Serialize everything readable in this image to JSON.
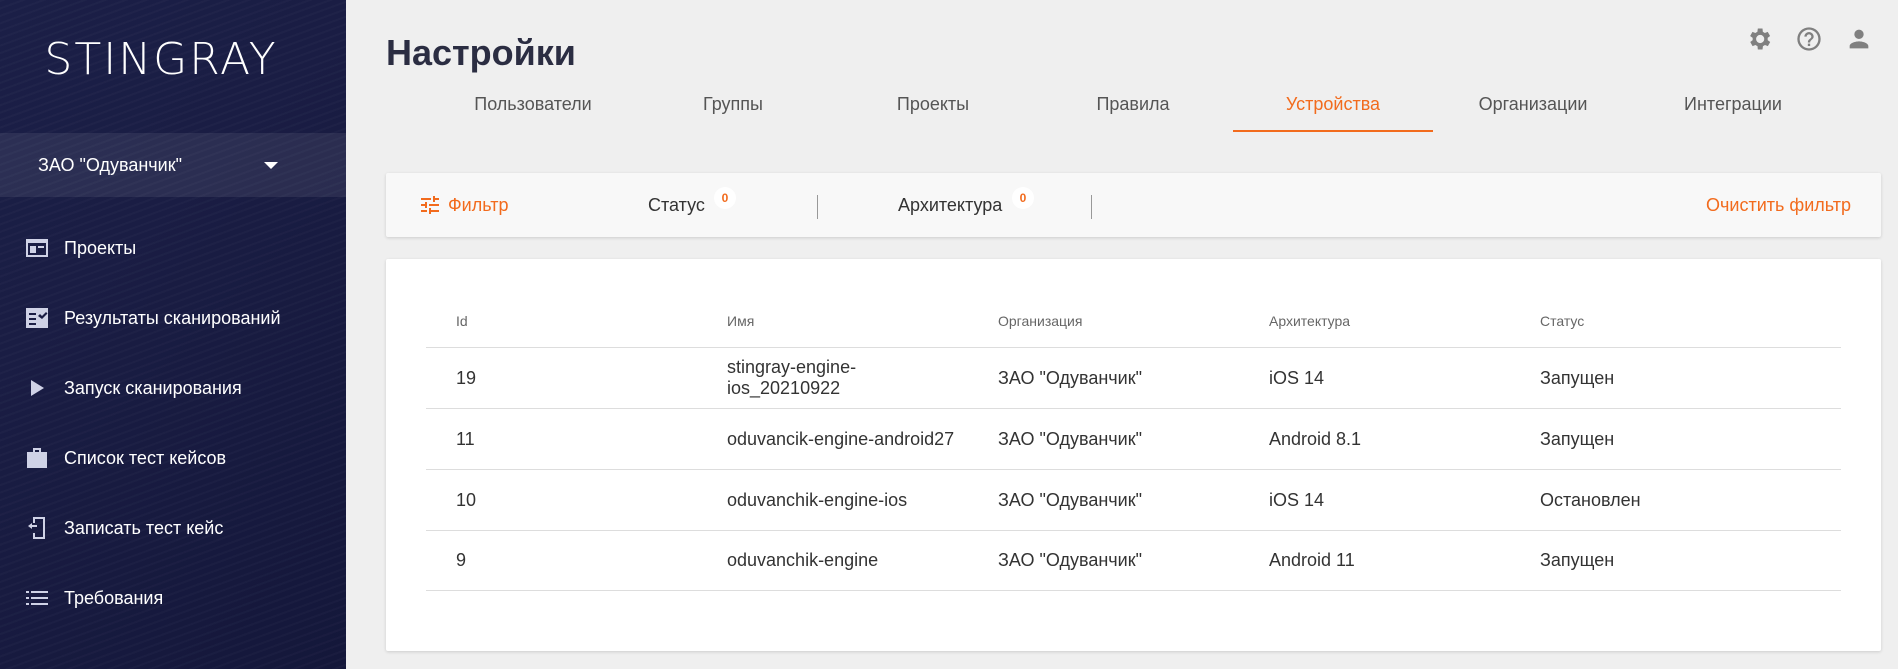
{
  "sidebar": {
    "logo": "STINGRAY",
    "org": "ЗАО \"Одуванчик\"",
    "items": [
      {
        "label": "Проекты",
        "icon": "projects-icon"
      },
      {
        "label": "Результаты сканирований",
        "icon": "scan-results-icon"
      },
      {
        "label": "Запуск сканирования",
        "icon": "play-icon"
      },
      {
        "label": "Список тест кейсов",
        "icon": "briefcase-icon"
      },
      {
        "label": "Записать тест кейс",
        "icon": "record-device-icon"
      },
      {
        "label": "Требования",
        "icon": "list-icon"
      }
    ]
  },
  "header": {
    "title": "Настройки",
    "icons": [
      "gear-icon",
      "help-icon",
      "user-icon"
    ]
  },
  "tabs": [
    "Пользователи",
    "Группы",
    "Проекты",
    "Правила",
    "Устройства",
    "Организации",
    "Интеграции"
  ],
  "active_tab": "Устройства",
  "filter": {
    "label": "Фильтр",
    "status_label": "Статус",
    "status_count": "0",
    "arch_label": "Архитектура",
    "arch_count": "0",
    "clear_label": "Очистить фильтр"
  },
  "table": {
    "headers": [
      "Id",
      "Имя",
      "Организация",
      "Архитектура",
      "Статус"
    ],
    "rows": [
      [
        "19",
        "stingray-engine-ios_20210922",
        "ЗАО \"Одуванчик\"",
        "iOS 14",
        "Запущен"
      ],
      [
        "11",
        "oduvancik-engine-android27",
        "ЗАО \"Одуванчик\"",
        "Android 8.1",
        "Запущен"
      ],
      [
        "10",
        "oduvanchik-engine-ios",
        "ЗАО \"Одуванчик\"",
        "iOS 14",
        "Остановлен"
      ],
      [
        "9",
        "oduvanchik-engine",
        "ЗАО \"Одуванчик\"",
        "Android 11",
        "Запущен"
      ]
    ]
  },
  "colors": {
    "accent": "#f26b1d",
    "sidebar_bg": "#1b1f47",
    "page_bg": "#efefef"
  }
}
